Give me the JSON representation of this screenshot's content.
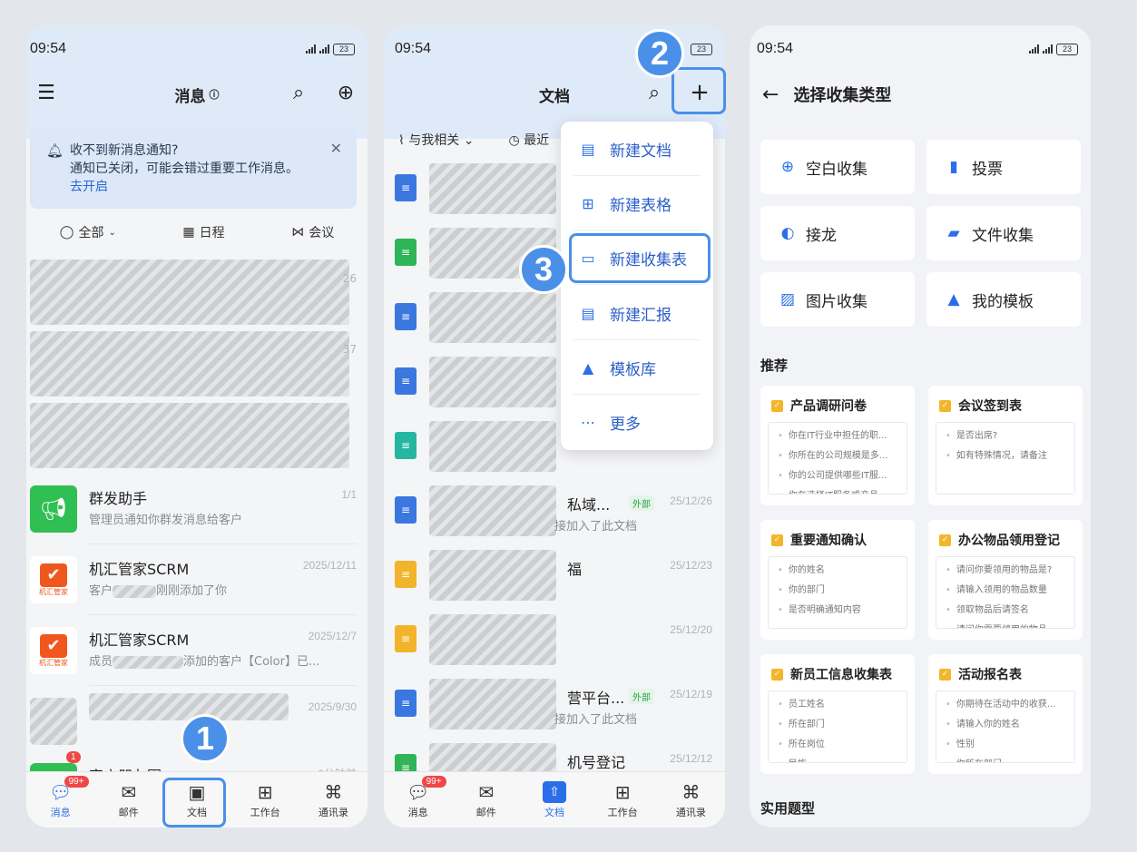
{
  "status": {
    "time": "09:54",
    "battery": "23"
  },
  "phone1": {
    "title": "消息",
    "notice": {
      "line1": "收不到新消息通知?",
      "line2": "通知已关闭，可能会错过重要工作消息。",
      "link": "去开启"
    },
    "filters": [
      "全部",
      "日程",
      "会议"
    ],
    "blurred_dates": [
      "26",
      "37"
    ],
    "chats": [
      {
        "name": "群发助手",
        "msg": "管理员通知你群发消息给客户",
        "date": "1/1"
      },
      {
        "name": "机汇管家SCRM",
        "msg_a": "客户",
        "msg_b": "刚刚添加了你",
        "date": "2025/12/11"
      },
      {
        "name": "机汇管家SCRM",
        "msg_a": "成员",
        "msg_b": "添加的客户【Color】已...",
        "date": "2025/12/7"
      },
      {
        "name": "",
        "msg": "",
        "date": "2025/9/30"
      },
      {
        "name": "客户朋友圈",
        "msg": "",
        "date": "2分钟前"
      }
    ],
    "brand_badge_text": "机汇管家",
    "chat_badge": "1",
    "tabs": [
      "消息",
      "邮件",
      "文档",
      "工作台",
      "通讯录"
    ],
    "msg_badge": "99+",
    "step": "1"
  },
  "phone2": {
    "title": "文档",
    "filters": [
      "与我相关",
      "最近"
    ],
    "menu": [
      "新建文档",
      "新建表格",
      "新建收集表",
      "新建汇报",
      "模板库",
      "更多"
    ],
    "docs": [
      {
        "t": "",
        "s": "",
        "d": ""
      },
      {
        "t": "",
        "s": "",
        "d": ""
      },
      {
        "t": "",
        "s": "",
        "d": ""
      },
      {
        "t": "",
        "s": "",
        "d": ""
      },
      {
        "t": "",
        "s": "",
        "d": ""
      },
      {
        "t": "私域...",
        "ext": "外部",
        "s": "接加入了此文档",
        "d": "25/12/26"
      },
      {
        "t": "福",
        "s": "",
        "d": "25/12/23"
      },
      {
        "t": "",
        "s": "",
        "d": "25/12/20"
      },
      {
        "t": "营平台...",
        "ext": "外部",
        "s": "接加入了此文档",
        "d": "25/12/19"
      },
      {
        "t": "机号登记",
        "s": "",
        "d": "25/12/12"
      }
    ],
    "tabs": [
      "消息",
      "邮件",
      "文档",
      "工作台",
      "通讯录"
    ],
    "msg_badge": "99+",
    "step2": "2",
    "step3": "3"
  },
  "phone3": {
    "title": "选择收集类型",
    "types": [
      "空白收集",
      "投票",
      "接龙",
      "文件收集",
      "图片收集",
      "我的模板"
    ],
    "section_recommend": "推荐",
    "section_practical": "实用题型",
    "templates": [
      {
        "title": "产品调研问卷",
        "items": [
          "你在IT行业中担任的职...",
          "你所在的公司规模是多...",
          "你的公司提供哪些IT服...",
          "你在选择IT服务或产品..."
        ]
      },
      {
        "title": "会议签到表",
        "items": [
          "是否出席?",
          "如有特殊情况，请备注"
        ]
      },
      {
        "title": "重要通知确认",
        "items": [
          "你的姓名",
          "你的部门",
          "是否明确通知内容"
        ]
      },
      {
        "title": "办公物品领用登记",
        "items": [
          "请问你要领用的物品是?",
          "请输入领用的物品数量",
          "领取物品后请签名",
          "请问你需要领用的物品..."
        ]
      },
      {
        "title": "新员工信息收集表",
        "items": [
          "员工姓名",
          "所在部门",
          "所在岗位",
          "民族"
        ]
      },
      {
        "title": "活动报名表",
        "items": [
          "你期待在活动中的收获...",
          "请输入你的姓名",
          "性别",
          "你所在部门"
        ]
      }
    ]
  },
  "colors": {
    "accent": "#2a6fe8",
    "highlight": "#4a90e8",
    "badge": "#f04848",
    "check": "#f3b62a"
  }
}
